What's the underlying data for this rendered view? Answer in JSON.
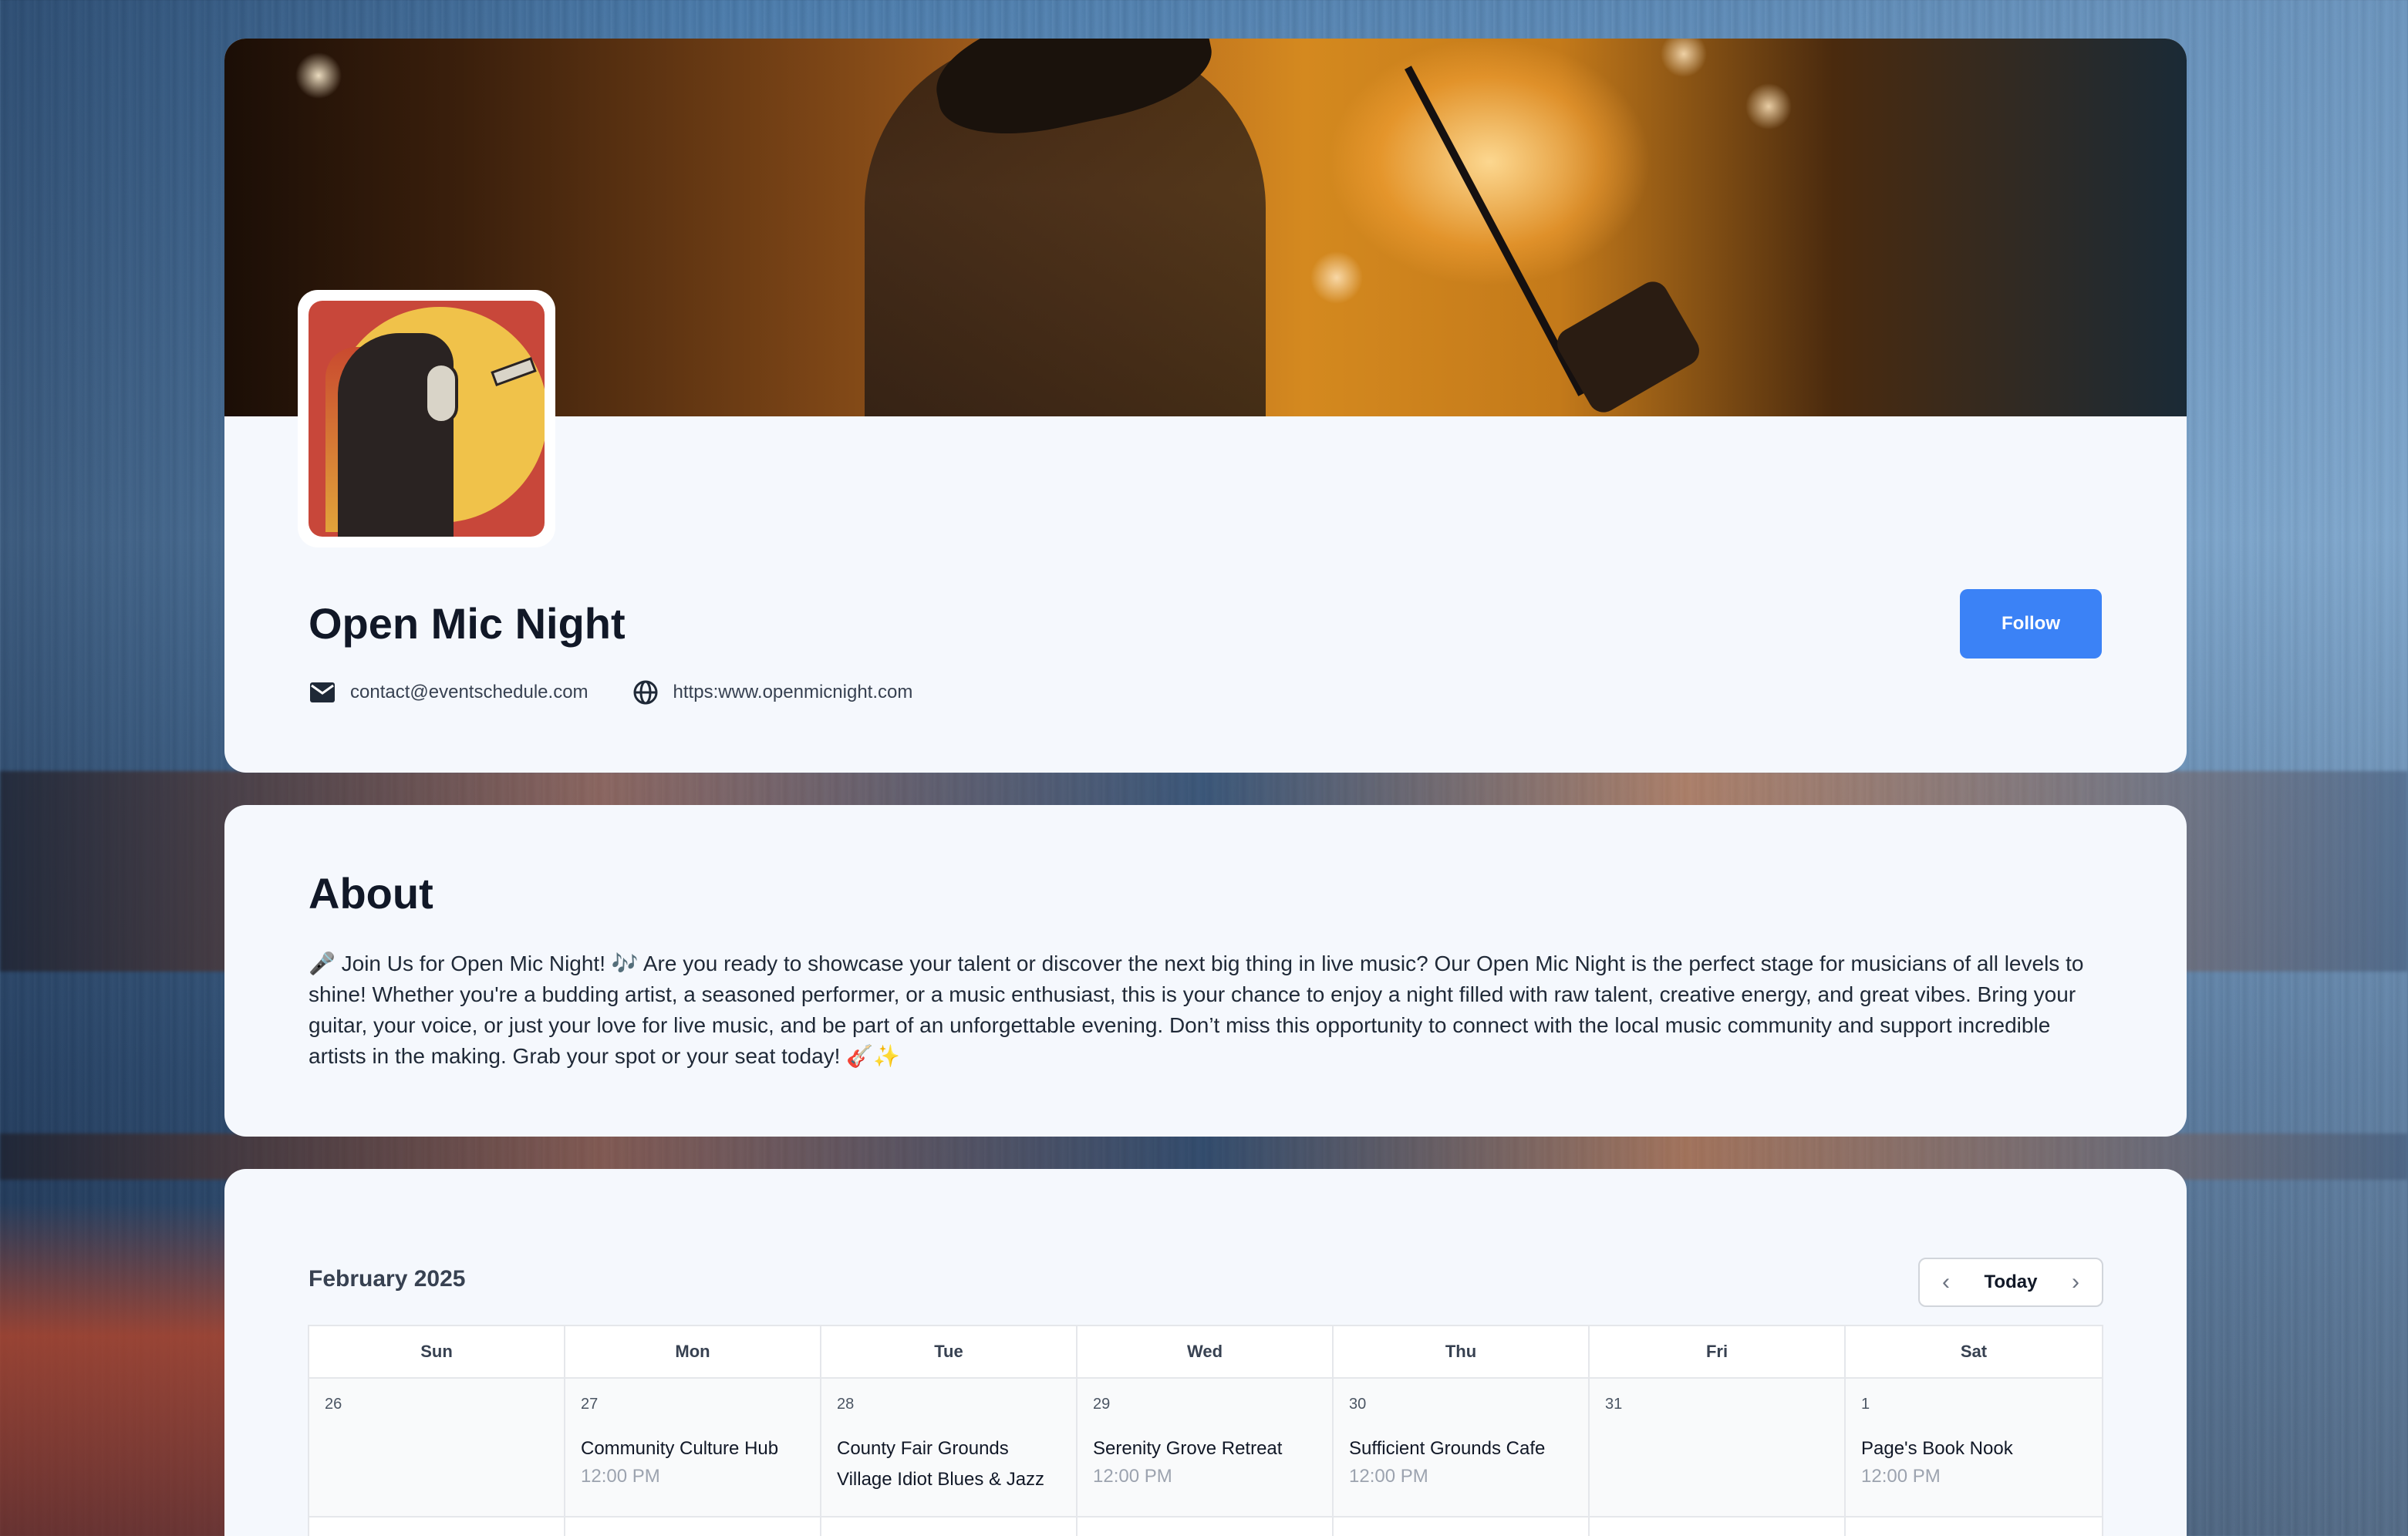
{
  "profile": {
    "name": "Open Mic Night",
    "follow_label": "Follow",
    "email": "contact@eventschedule.com",
    "website": "https:www.openmicnight.com"
  },
  "about": {
    "title": "About",
    "text": "🎤 Join Us for Open Mic Night! 🎶 Are you ready to showcase your talent or discover the next big thing in live music? Our Open Mic Night is the perfect stage for musicians of all levels to shine! Whether you're a budding artist, a seasoned performer, or a music enthusiast, this is your chance to enjoy a night filled with raw talent, creative energy, and great vibes. Bring your guitar, your voice, or just your love for live music, and be part of an unforgettable evening. Don’t miss this opportunity to connect with the local music community and support incredible artists in the making. Grab your spot or your seat today! 🎸✨"
  },
  "calendar": {
    "month_label": "February 2025",
    "today_label": "Today",
    "prev_icon": "chevron-left-icon",
    "next_icon": "chevron-right-icon",
    "weekdays": [
      "Sun",
      "Mon",
      "Tue",
      "Wed",
      "Thu",
      "Fri",
      "Sat"
    ],
    "week1": [
      {
        "day": "26",
        "events": [],
        "time": ""
      },
      {
        "day": "27",
        "events": [
          "Community Culture Hub"
        ],
        "time": "12:00 PM"
      },
      {
        "day": "28",
        "events": [
          "County Fair Grounds",
          "Village Idiot Blues & Jazz"
        ],
        "time": ""
      },
      {
        "day": "29",
        "events": [
          "Serenity Grove Retreat"
        ],
        "time": "12:00 PM"
      },
      {
        "day": "30",
        "events": [
          "Sufficient Grounds Cafe"
        ],
        "time": "12:00 PM"
      },
      {
        "day": "31",
        "events": [],
        "time": ""
      },
      {
        "day": "1",
        "events": [
          "Page's Book Nook"
        ],
        "time": "12:00 PM"
      }
    ]
  },
  "colors": {
    "accent": "#3b82f6",
    "card_bg": "#f5f8fd"
  }
}
